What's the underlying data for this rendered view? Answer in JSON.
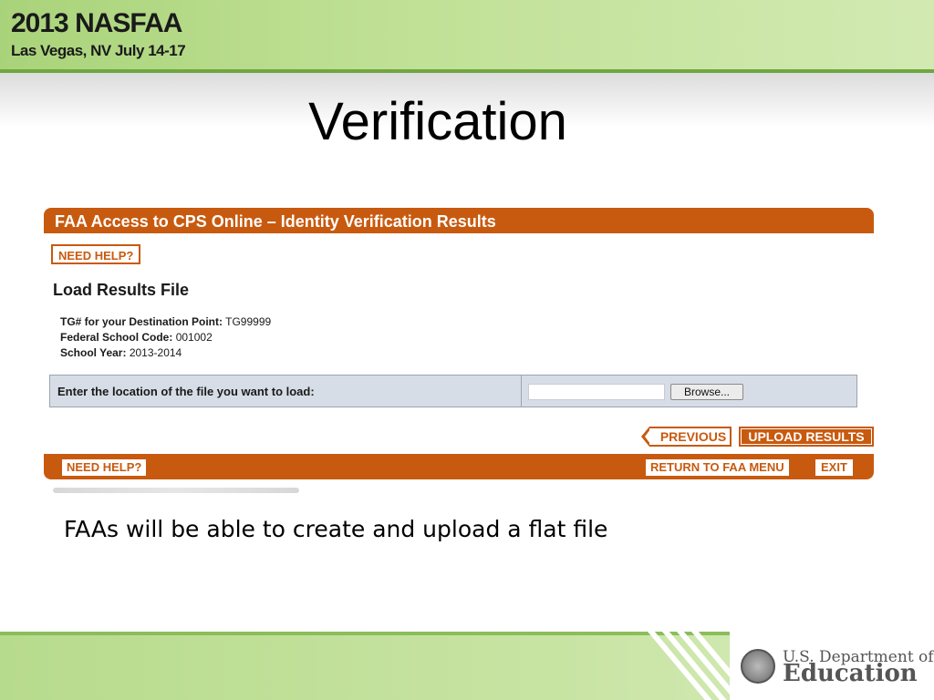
{
  "banner": {
    "title": "2013 NASFAA",
    "subtitle": "Las Vegas, NV July 14-17"
  },
  "slide": {
    "title": "Verification",
    "caption": "FAAs will be able to create and upload a flat file"
  },
  "screenshot": {
    "header_title": "FAA Access to CPS Online – Identity Verification Results",
    "need_help_label": "NEED HELP?",
    "section_title": "Load Results File",
    "info": [
      {
        "label": "TG# for your Destination Point:",
        "value": "TG99999"
      },
      {
        "label": "Federal School Code:",
        "value": "001002"
      },
      {
        "label": "School Year:",
        "value": "2013-2014"
      }
    ],
    "file_prompt": "Enter the location of the file you want to load:",
    "file_value": "",
    "browse_label": "Browse...",
    "previous_label": "PREVIOUS",
    "upload_label": "UPLOAD RESULTS",
    "footer": {
      "need_help_label": "NEED HELP?",
      "return_label": "RETURN TO FAA MENU",
      "exit_label": "EXIT"
    }
  },
  "logo": {
    "department": "U.S. Department of",
    "agency": "Education"
  },
  "colors": {
    "accent_orange": "#c85a0f",
    "banner_green": "#a9d37a"
  },
  "icons": [
    "seal-icon",
    "chevron-left-icon"
  ]
}
